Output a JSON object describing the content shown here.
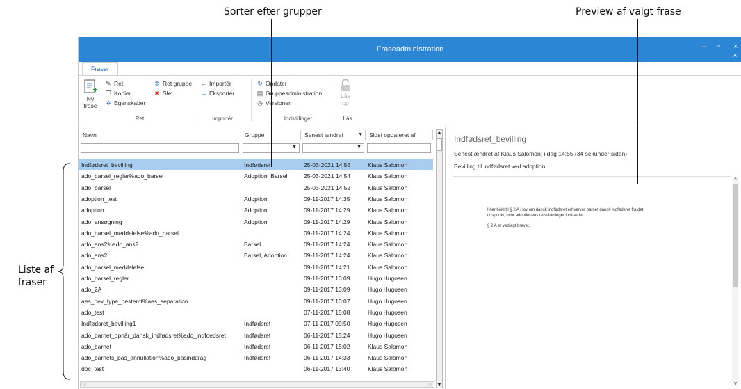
{
  "annotations": {
    "sort_groups": "Sorter efter grupper",
    "preview": "Preview af valgt frase",
    "list_line1": "Liste af",
    "list_line2": "fraser"
  },
  "window": {
    "title": "Fraseadministration",
    "minimize": "‒",
    "maximize": "▫",
    "close": "×",
    "collapse": "^"
  },
  "tab": "Fraser",
  "ribbon": {
    "ny": "Ny",
    "frase": "frase",
    "ret": "Ret",
    "kopier": "Kopier",
    "egenskaber": "Egenskaber",
    "ret_gruppe": "Ret gruppe",
    "slet": "Slet",
    "group_ret": "Ret",
    "importer": "Importér",
    "eksporter": "Eksportér",
    "group_importer": "Importér",
    "opdater": "Opdater",
    "gruppeadministration": "Gruppeadministration",
    "versioner": "Versioner",
    "group_indstillinger": "Indstillinger",
    "laas_op_1": "Lås",
    "laas_op_2": "op",
    "group_laas": "Lås"
  },
  "columns": {
    "navn": "Navn",
    "gruppe": "Gruppe",
    "senest": "Senest ændret",
    "sidst": "Sidst opdateret af"
  },
  "rows": [
    {
      "navn": "Indfødsret_bevilling",
      "gruppe": "Indfødsret",
      "dato": "25-03-2021 14:55",
      "af": "Klaus Salomon"
    },
    {
      "navn": "ado_barsel_regler%ado_barsel",
      "gruppe": "Adoption, Barsel",
      "dato": "25-03-2021 14:54",
      "af": "Klaus Salomon"
    },
    {
      "navn": "ado_barsel",
      "gruppe": "",
      "dato": "25-03-2021 14:52",
      "af": "Klaus Salomon"
    },
    {
      "navn": "adoption_test",
      "gruppe": "Adoption",
      "dato": "09-11-2017 14:35",
      "af": "Klaus Salomon"
    },
    {
      "navn": "adoption",
      "gruppe": "Adoption",
      "dato": "09-11-2017 14:29",
      "af": "Klaus Salomon"
    },
    {
      "navn": "ado_ansøgning",
      "gruppe": "Adoption",
      "dato": "09-11-2017 14:29",
      "af": "Klaus Salomon"
    },
    {
      "navn": "ado_barsel_meddelelse%ado_barsel",
      "gruppe": "",
      "dato": "09-11-2017 14:24",
      "af": "Klaus Salomon"
    },
    {
      "navn": "ado_ans2%ado_ans2",
      "gruppe": "Barsel",
      "dato": "09-11-2017 14:24",
      "af": "Klaus Salomon"
    },
    {
      "navn": "ado_ans2",
      "gruppe": "Barsel, Adoption",
      "dato": "09-11-2017 14:24",
      "af": "Klaus Salomon"
    },
    {
      "navn": "ado_barsel_meddelelse",
      "gruppe": "",
      "dato": "09-11-2017 14:21",
      "af": "Klaus Salomon"
    },
    {
      "navn": "ado_barsel_regler",
      "gruppe": "",
      "dato": "09-11-2017 13:09",
      "af": "Hugo Hugosen"
    },
    {
      "navn": "ado_2A",
      "gruppe": "",
      "dato": "09-11-2017 13:09",
      "af": "Hugo Hugosen"
    },
    {
      "navn": "aes_bev_type_bestemt%aes_separation",
      "gruppe": "",
      "dato": "09-11-2017 13:07",
      "af": "Hugo Hugosen"
    },
    {
      "navn": "ado_test",
      "gruppe": "",
      "dato": "07-11-2017 15:08",
      "af": "Hugo Hugosen"
    },
    {
      "navn": "Indfødsret_bevilling1",
      "gruppe": "Indfødsret",
      "dato": "07-11-2017 09:50",
      "af": "Hugo Hugosen"
    },
    {
      "navn": "ado_barnet_opnår_dansk_indfødsret%ado_indfoedsret",
      "gruppe": "Indfødsret",
      "dato": "06-11-2017 15:24",
      "af": "Hugo Hugosen"
    },
    {
      "navn": "ado_barnet",
      "gruppe": "Indfødsret",
      "dato": "06-11-2017 15:02",
      "af": "Klaus Salomon"
    },
    {
      "navn": "ado_barnets_pas_annullation%ado_pasinddrag",
      "gruppe": "Indfødsret",
      "dato": "06-11-2017 14:33",
      "af": "Klaus Salomon"
    },
    {
      "navn": "doc_test",
      "gruppe": "",
      "dato": "06-11-2017 13:40",
      "af": "Klaus Salomon"
    }
  ],
  "preview": {
    "title": "Indfødsret_bevilling",
    "meta": "Senest ændret af Klaus Salomon; i dag 14:55 (34 sekunder siden)",
    "description": "Bevilling til indfødsret ved adoption",
    "body_line1": "I henhold til § 2 A i lov om dansk indfødsret erhverver barnet dansk indfødsret fra det",
    "body_line2": "tidspunkt, hvor adoptionens retsvirkninger indtræder.",
    "body_line3": "§ 2 A er vedlagt brevet."
  }
}
